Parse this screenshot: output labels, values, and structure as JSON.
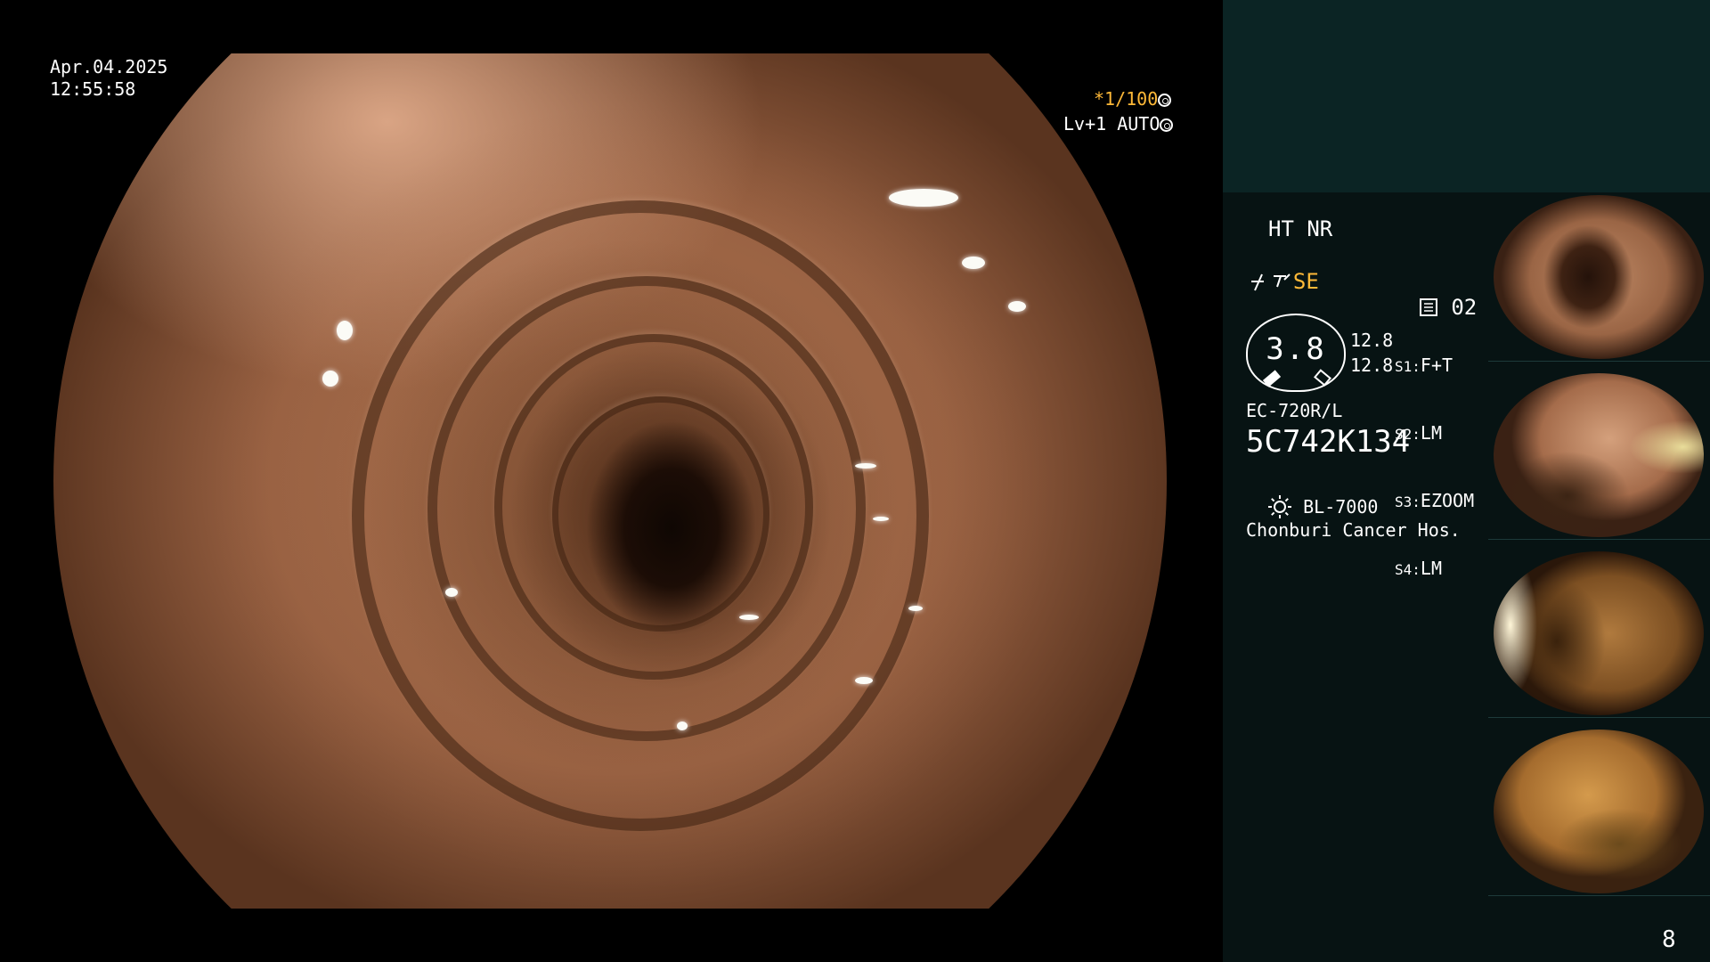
{
  "overlay": {
    "date": "Apr.04.2025",
    "time": "12:55:58",
    "shutter": "*1/100",
    "shutter_icon": "aperture-icon",
    "level_auto": "Lv+1 AUTO",
    "level_icon": "iris-icon"
  },
  "side_panel": {
    "mode": "HT NR",
    "se_label": "SE",
    "memory_label": "02",
    "intensity_value": "3.8",
    "value_1": "12.8",
    "value_2": "12.8",
    "switches": [
      {
        "key": "S1:",
        "value": "F+T"
      },
      {
        "key": "S2:",
        "value": "LM"
      },
      {
        "key": "S3:",
        "value": "EZOOM"
      },
      {
        "key": "S4:",
        "value": "LM"
      }
    ],
    "scope_model": "EC-720R/L",
    "scope_serial": "5C742K134",
    "light_source": "BL-7000",
    "hospital": "Chonburi Cancer Hos.",
    "page_number": "8"
  },
  "colors": {
    "panel_top": "#0b2424",
    "panel_side": "#071313",
    "accent_orange": "#ffb938"
  }
}
